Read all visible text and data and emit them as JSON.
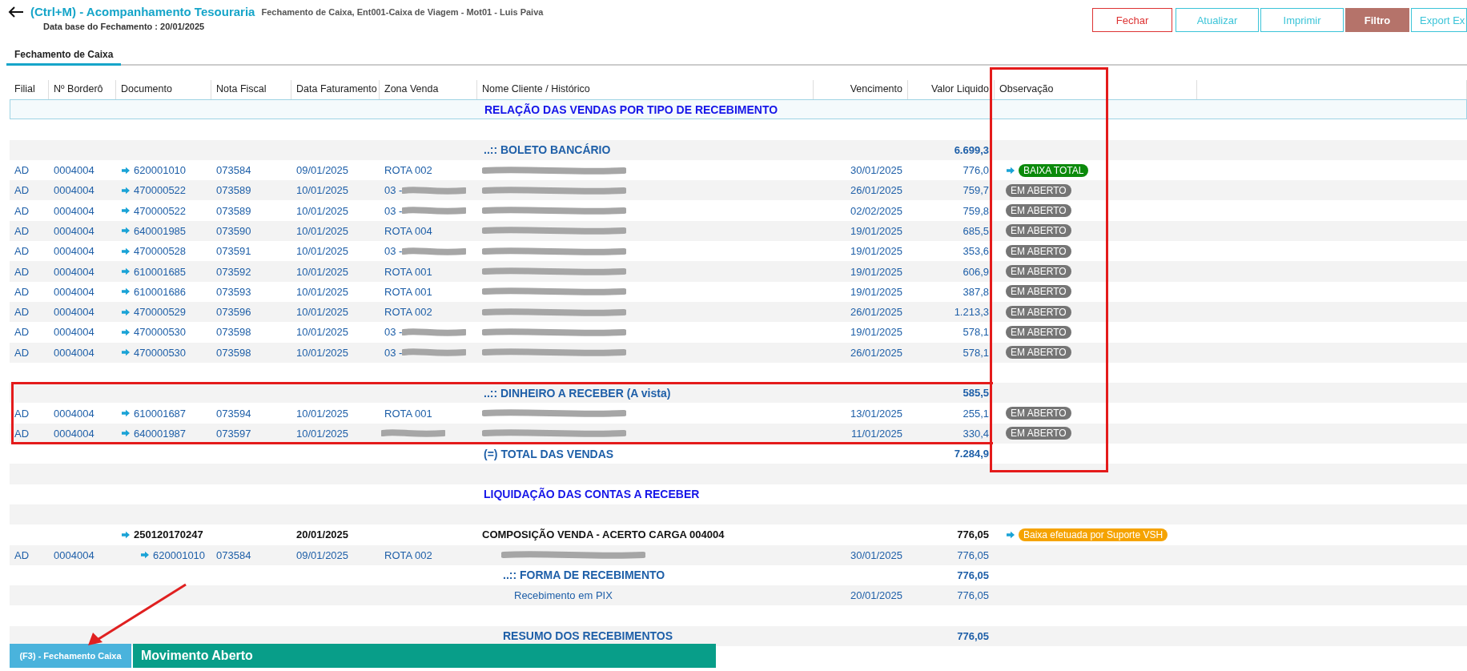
{
  "header": {
    "title": "(Ctrl+M) - Acompanhamento Tesouraria",
    "subtitle": "Fechamento de Caixa, Ent001-Caixa de Viagem - Mot01 - Luis Paiva",
    "base_date": "Data base do Fechamento : 20/01/2025"
  },
  "actions": [
    {
      "label": "Fechar",
      "kind": "danger"
    },
    {
      "label": "Atualizar",
      "kind": "outline"
    },
    {
      "label": "Imprimir",
      "kind": "outline"
    },
    {
      "label": "Filtro",
      "kind": "filled"
    },
    {
      "label": "Export Ex",
      "kind": "outline"
    }
  ],
  "tabs": [
    {
      "label": "Fechamento de Caixa",
      "selected": true
    }
  ],
  "table": {
    "columns": [
      "Filial",
      "Nº Borderô",
      "Documento",
      "Nota Fiscal",
      "Data Faturamento",
      "Zona Venda",
      "Nome Cliente / Histórico",
      "Vencimento",
      "Valor Liquido",
      "Observação"
    ],
    "rows": [
      {
        "kind": "title",
        "text": "RELAÇÃO DAS VENDAS POR TIPO DE RECEBIMENTO"
      },
      {
        "kind": "spacer"
      },
      {
        "kind": "group",
        "text": "..:: BOLETO BANCÁRIO",
        "valor": "6.699,3"
      },
      {
        "kind": "item",
        "filial": "AD",
        "bordero": "0004004",
        "documento": "620001010",
        "nota": "073584",
        "data": "09/01/2025",
        "zona": "ROTA 002",
        "zona_scribbled": false,
        "cliente_scribbled": true,
        "vencimento": "30/01/2025",
        "valor": "776,0",
        "obs": {
          "text": "BAIXA TOTAL",
          "color": "#0b8a0b",
          "arrow": true
        }
      },
      {
        "kind": "item",
        "filial": "AD",
        "bordero": "0004004",
        "documento": "470000522",
        "nota": "073589",
        "data": "10/01/2025",
        "zona": "03 -",
        "zona_scribbled": true,
        "cliente_scribbled": true,
        "vencimento": "26/01/2025",
        "valor": "759,7",
        "obs": {
          "text": "EM ABERTO",
          "color": "#757575",
          "arrow": false
        }
      },
      {
        "kind": "item",
        "filial": "AD",
        "bordero": "0004004",
        "documento": "470000522",
        "nota": "073589",
        "data": "10/01/2025",
        "zona": "03 -",
        "zona_scribbled": true,
        "cliente_scribbled": true,
        "vencimento": "02/02/2025",
        "valor": "759,8",
        "obs": {
          "text": "EM ABERTO",
          "color": "#757575",
          "arrow": false
        }
      },
      {
        "kind": "item",
        "filial": "AD",
        "bordero": "0004004",
        "documento": "640001985",
        "nota": "073590",
        "data": "10/01/2025",
        "zona": "ROTA 004",
        "zona_scribbled": false,
        "cliente_scribbled": true,
        "vencimento": "19/01/2025",
        "valor": "685,5",
        "obs": {
          "text": "EM ABERTO",
          "color": "#757575",
          "arrow": false
        }
      },
      {
        "kind": "item",
        "filial": "AD",
        "bordero": "0004004",
        "documento": "470000528",
        "nota": "073591",
        "data": "10/01/2025",
        "zona": "03 -",
        "zona_scribbled": true,
        "cliente_scribbled": true,
        "vencimento": "19/01/2025",
        "valor": "353,6",
        "obs": {
          "text": "EM ABERTO",
          "color": "#757575",
          "arrow": false
        }
      },
      {
        "kind": "item",
        "filial": "AD",
        "bordero": "0004004",
        "documento": "610001685",
        "nota": "073592",
        "data": "10/01/2025",
        "zona": "ROTA 001",
        "zona_scribbled": false,
        "cliente_scribbled": true,
        "vencimento": "19/01/2025",
        "valor": "606,9",
        "obs": {
          "text": "EM ABERTO",
          "color": "#757575",
          "arrow": false
        }
      },
      {
        "kind": "item",
        "filial": "AD",
        "bordero": "0004004",
        "documento": "610001686",
        "nota": "073593",
        "data": "10/01/2025",
        "zona": "ROTA 001",
        "zona_scribbled": false,
        "cliente_scribbled": true,
        "vencimento": "19/01/2025",
        "valor": "387,8",
        "obs": {
          "text": "EM ABERTO",
          "color": "#757575",
          "arrow": false
        }
      },
      {
        "kind": "item",
        "filial": "AD",
        "bordero": "0004004",
        "documento": "470000529",
        "nota": "073596",
        "data": "10/01/2025",
        "zona": "ROTA 002",
        "zona_scribbled": false,
        "cliente_scribbled": true,
        "vencimento": "26/01/2025",
        "valor": "1.213,3",
        "obs": {
          "text": "EM ABERTO",
          "color": "#757575",
          "arrow": false
        }
      },
      {
        "kind": "item",
        "filial": "AD",
        "bordero": "0004004",
        "documento": "470000530",
        "nota": "073598",
        "data": "10/01/2025",
        "zona": "03 -",
        "zona_scribbled": true,
        "cliente_scribbled": true,
        "vencimento": "19/01/2025",
        "valor": "578,1",
        "obs": {
          "text": "EM ABERTO",
          "color": "#757575",
          "arrow": false
        }
      },
      {
        "kind": "item",
        "filial": "AD",
        "bordero": "0004004",
        "documento": "470000530",
        "nota": "073598",
        "data": "10/01/2025",
        "zona": "03 -",
        "zona_scribbled": true,
        "cliente_scribbled": true,
        "vencimento": "26/01/2025",
        "valor": "578,1",
        "obs": {
          "text": "EM ABERTO",
          "color": "#757575",
          "arrow": false
        }
      },
      {
        "kind": "spacer"
      },
      {
        "kind": "group",
        "text": "..:: DINHEIRO A RECEBER (A vista)",
        "valor": "585,5"
      },
      {
        "kind": "item",
        "filial": "AD",
        "bordero": "0004004",
        "documento": "610001687",
        "nota": "073594",
        "data": "10/01/2025",
        "zona": "ROTA 001",
        "zona_scribbled": false,
        "cliente_scribbled": true,
        "vencimento": "13/01/2025",
        "valor": "255,1",
        "obs": {
          "text": "EM ABERTO",
          "color": "#757575",
          "arrow": false
        }
      },
      {
        "kind": "item",
        "filial": "AD",
        "bordero": "0004004",
        "documento": "640001987",
        "nota": "073597",
        "data": "10/01/2025",
        "zona_scribbled": true,
        "cliente_scribbled": true,
        "vencimento": "11/01/2025",
        "valor": "330,4",
        "obs": {
          "text": "EM ABERTO",
          "color": "#757575",
          "arrow": false
        }
      },
      {
        "kind": "group",
        "text": "(=) TOTAL DAS VENDAS",
        "valor": "7.284,9"
      },
      {
        "kind": "spacer"
      },
      {
        "kind": "title",
        "text": "LIQUIDAÇÃO DAS CONTAS A RECEBER"
      },
      {
        "kind": "spacer"
      },
      {
        "kind": "summary",
        "documento": "250120170247",
        "data": "20/01/2025",
        "text": "COMPOSIÇÃO VENDA - ACERTO CARGA 004004",
        "valor": "776,05",
        "obs": {
          "text": "Baixa efetuada por Suporte VSH",
          "color": "#f5a300",
          "arrow": true
        }
      },
      {
        "kind": "subitem",
        "filial": "AD",
        "bordero": "0004004",
        "documento": "620001010",
        "nota": "073584",
        "data": "09/01/2025",
        "zona": "ROTA 002",
        "zona_scribbled": false,
        "cliente_scribbled": true,
        "vencimento": "30/01/2025",
        "valor": "776,05"
      },
      {
        "kind": "subgroup",
        "text": "..:: FORMA DE RECEBIMENTO",
        "valor": "776,05"
      },
      {
        "kind": "payment",
        "text": "Recebimento em PIX",
        "vencimento": "20/01/2025",
        "valor": "776,05"
      },
      {
        "kind": "spacer"
      },
      {
        "kind": "subgroup",
        "text": "RESUMO DOS RECEBIMENTOS",
        "valor": "776,05"
      }
    ]
  },
  "footer_tabs": [
    {
      "label": "(F3) - Fechamento Caixa",
      "kind": "tab"
    },
    {
      "label": "Movimento Aberto",
      "kind": "status"
    }
  ]
}
